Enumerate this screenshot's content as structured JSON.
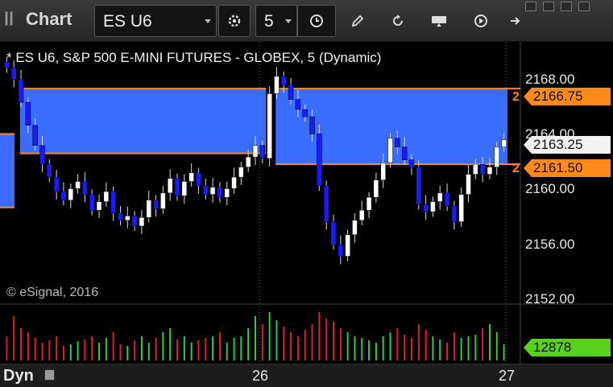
{
  "toolbar": {
    "title": "Chart",
    "symbol": "ES U6",
    "interval": "5",
    "icons": [
      "grip-icon",
      "chevron-down-icon",
      "gear-icon",
      "clock-icon",
      "pencil-icon",
      "refresh-icon",
      "get-icon",
      "play-icon",
      "right-arrow-icon"
    ]
  },
  "chart": {
    "title": "* ES U6, S&P 500 E-MINI FUTURES - GLOBEX, 5 (Dynamic)",
    "copyright": "© eSignal, 2016",
    "price_axis": [
      "2168.00",
      "2164.00",
      "2160.00",
      "2156.00",
      "2152.00"
    ],
    "levels": [
      {
        "count": "2",
        "price": "2166.75"
      },
      {
        "count": "2",
        "price": "2161.50"
      }
    ],
    "last_price": "2163.25",
    "volume_last": "12878",
    "x_labels": [
      "26",
      "27"
    ],
    "mode": "Dyn",
    "colors": {
      "up": "#ffffff",
      "down": "#1a1aff",
      "zone": "#3a6cff",
      "level": "#ff8a1a",
      "volume_up": "#2ecc40",
      "volume_down": "#e02020",
      "tag_green": "#58d21e"
    }
  },
  "chart_data": {
    "type": "candlestick",
    "ylim": [
      2152,
      2170
    ],
    "levels": [
      2166.75,
      2161.5
    ],
    "zones": [
      {
        "from_index": 1,
        "to_index": 37,
        "y_top": 2166.75,
        "y_bottom": 2162.25
      },
      {
        "from_index": 37,
        "to_index": 71,
        "y_top": 2166.75,
        "y_bottom": 2161.5
      }
    ],
    "closes": [
      2168.2,
      2167.4,
      2165.8,
      2164.2,
      2162.8,
      2161.5,
      2160.6,
      2159.6,
      2159.0,
      2159.8,
      2160.3,
      2159.4,
      2158.3,
      2158.9,
      2159.6,
      2158.1,
      2157.6,
      2157.9,
      2157.2,
      2157.8,
      2159.0,
      2158.4,
      2159.5,
      2160.5,
      2159.3,
      2160.3,
      2160.9,
      2160.0,
      2159.4,
      2159.9,
      2159.2,
      2159.8,
      2160.6,
      2161.3,
      2162.0,
      2162.8,
      2161.9,
      2166.4,
      2167.6,
      2167.0,
      2166.0,
      2165.3,
      2164.8,
      2163.6,
      2160.0,
      2157.5,
      2155.9,
      2155.1,
      2156.6,
      2157.6,
      2158.3,
      2159.2,
      2160.4,
      2161.6,
      2163.3,
      2162.7,
      2161.8,
      2161.3,
      2158.7,
      2158.2,
      2158.9,
      2159.5,
      2158.6,
      2157.5,
      2159.4,
      2160.8,
      2161.5,
      2160.8,
      2161.3,
      2162.7,
      2163.2
    ],
    "opens": [
      2168.6,
      2168.2,
      2167.4,
      2165.8,
      2164.2,
      2162.8,
      2161.5,
      2160.6,
      2159.6,
      2159.0,
      2159.8,
      2160.3,
      2159.4,
      2158.3,
      2158.9,
      2159.6,
      2158.1,
      2157.6,
      2157.9,
      2157.2,
      2157.8,
      2159.0,
      2158.4,
      2159.5,
      2160.5,
      2159.3,
      2160.3,
      2160.9,
      2160.0,
      2159.4,
      2159.9,
      2159.2,
      2159.8,
      2160.6,
      2161.3,
      2162.0,
      2162.8,
      2161.9,
      2166.4,
      2167.6,
      2167.0,
      2166.0,
      2165.3,
      2164.8,
      2163.6,
      2160.0,
      2157.5,
      2155.9,
      2155.1,
      2156.6,
      2157.6,
      2158.3,
      2159.2,
      2160.4,
      2161.6,
      2163.3,
      2162.7,
      2161.8,
      2161.3,
      2158.7,
      2158.2,
      2158.9,
      2159.5,
      2158.6,
      2157.5,
      2159.4,
      2160.8,
      2161.5,
      2160.8,
      2161.3,
      2162.7
    ],
    "volume": [
      30,
      55,
      40,
      35,
      28,
      22,
      25,
      30,
      18,
      20,
      24,
      26,
      30,
      22,
      28,
      35,
      20,
      18,
      25,
      30,
      22,
      28,
      35,
      40,
      26,
      30,
      22,
      25,
      28,
      30,
      35,
      22,
      28,
      30,
      40,
      55,
      45,
      60,
      50,
      42,
      35,
      30,
      38,
      45,
      60,
      52,
      48,
      40,
      35,
      30,
      28,
      25,
      22,
      30,
      35,
      40,
      32,
      28,
      45,
      38,
      30,
      26,
      22,
      35,
      28,
      30,
      32,
      40,
      45,
      35,
      20
    ]
  }
}
